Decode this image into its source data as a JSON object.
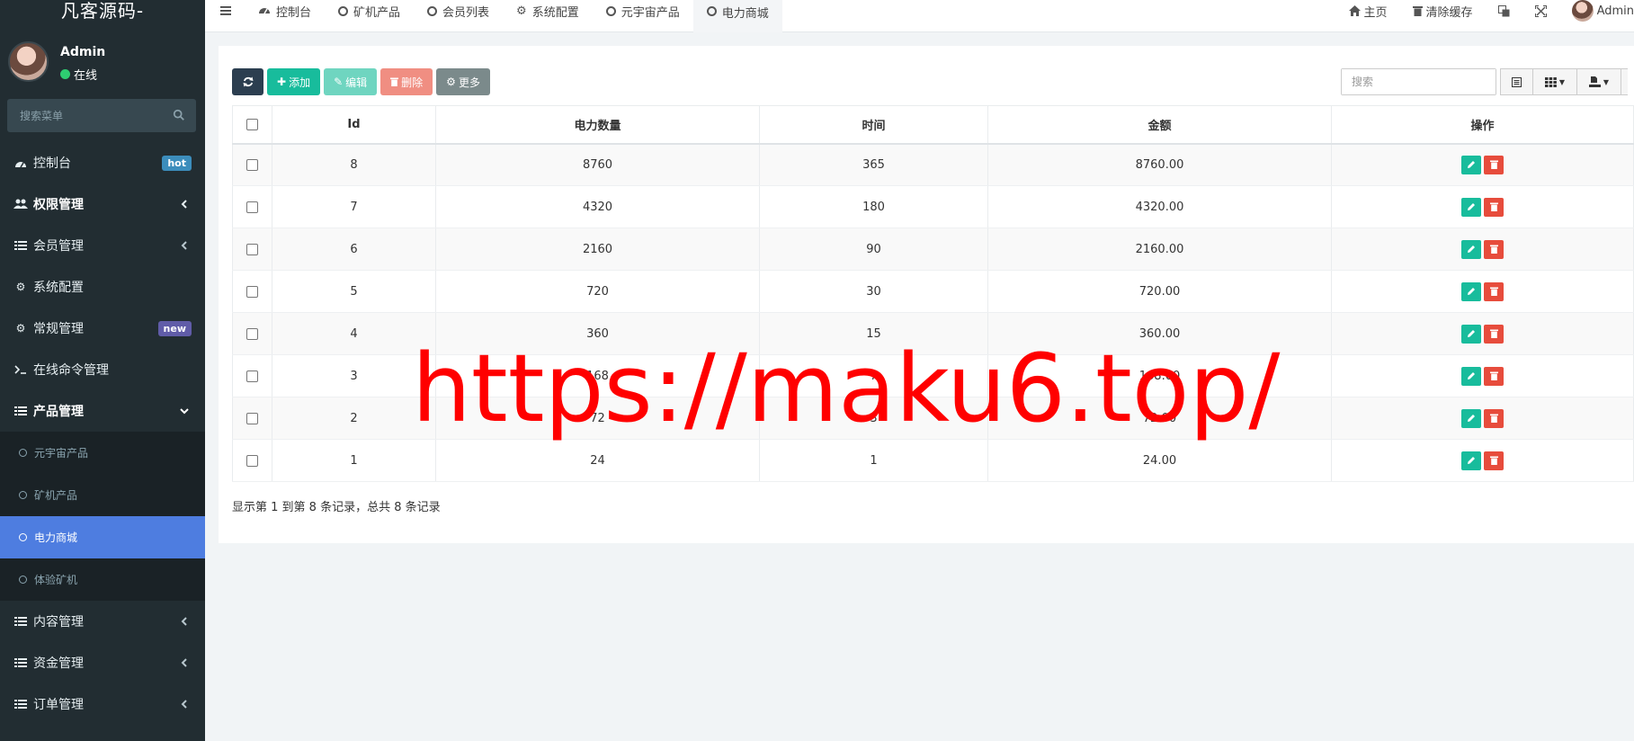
{
  "sidebar": {
    "brand": "凡客源码-",
    "user": {
      "name": "Admin",
      "status": "在线"
    },
    "search_placeholder": "搜索菜单",
    "menu": [
      {
        "label": "控制台",
        "icon": "dashboard-icon",
        "badge": "hot"
      },
      {
        "label": "权限管理",
        "icon": "users-icon",
        "bold": true
      },
      {
        "label": "会员管理",
        "icon": "list-icon"
      },
      {
        "label": "系统配置",
        "icon": "gear-icon"
      },
      {
        "label": "常规管理",
        "icon": "cogs-icon",
        "badge": "new"
      },
      {
        "label": "在线命令管理",
        "icon": "terminal-icon"
      },
      {
        "label": "产品管理",
        "icon": "list-icon",
        "bold": true,
        "expanded": true
      }
    ],
    "submenu": [
      {
        "label": "元宇宙产品"
      },
      {
        "label": "矿机产品"
      },
      {
        "label": "电力商城",
        "active": true
      },
      {
        "label": "体验矿机"
      }
    ],
    "menu_after": [
      {
        "label": "内容管理",
        "icon": "list-icon"
      },
      {
        "label": "资金管理",
        "icon": "list-icon"
      },
      {
        "label": "订单管理",
        "icon": "list-icon"
      }
    ]
  },
  "topbar": {
    "tabs": [
      {
        "label": "控制台",
        "icon": "dashboard-icon"
      },
      {
        "label": "矿机产品",
        "icon": "circle-icon"
      },
      {
        "label": "会员列表",
        "icon": "circle-icon"
      },
      {
        "label": "系统配置",
        "icon": "gear-icon"
      },
      {
        "label": "元宇宙产品",
        "icon": "circle-icon"
      },
      {
        "label": "电力商城",
        "icon": "circle-icon",
        "active": true
      }
    ],
    "right": {
      "home": "主页",
      "clear_cache": "清除缓存",
      "user": "Admin"
    }
  },
  "toolbar": {
    "add": "添加",
    "edit": "编辑",
    "delete": "删除",
    "more": "更多",
    "search_placeholder": "搜索"
  },
  "table": {
    "headers": [
      "Id",
      "电力数量",
      "时间",
      "金额",
      "操作"
    ],
    "rows": [
      [
        "8",
        "8760",
        "365",
        "8760.00"
      ],
      [
        "7",
        "4320",
        "180",
        "4320.00"
      ],
      [
        "6",
        "2160",
        "90",
        "2160.00"
      ],
      [
        "5",
        "720",
        "30",
        "720.00"
      ],
      [
        "4",
        "360",
        "15",
        "360.00"
      ],
      [
        "3",
        "168",
        "7",
        "168.00"
      ],
      [
        "2",
        "72",
        "3",
        "72.00"
      ],
      [
        "1",
        "24",
        "1",
        "24.00"
      ]
    ]
  },
  "pager": "显示第 1 到第 8 条记录，总共 8 条记录",
  "watermark": "https://maku6.top/",
  "colors": {
    "sidebar_bg": "#222d32",
    "active_menu": "#4e7de0",
    "success": "#18bc9c",
    "danger": "#e74c3c"
  }
}
